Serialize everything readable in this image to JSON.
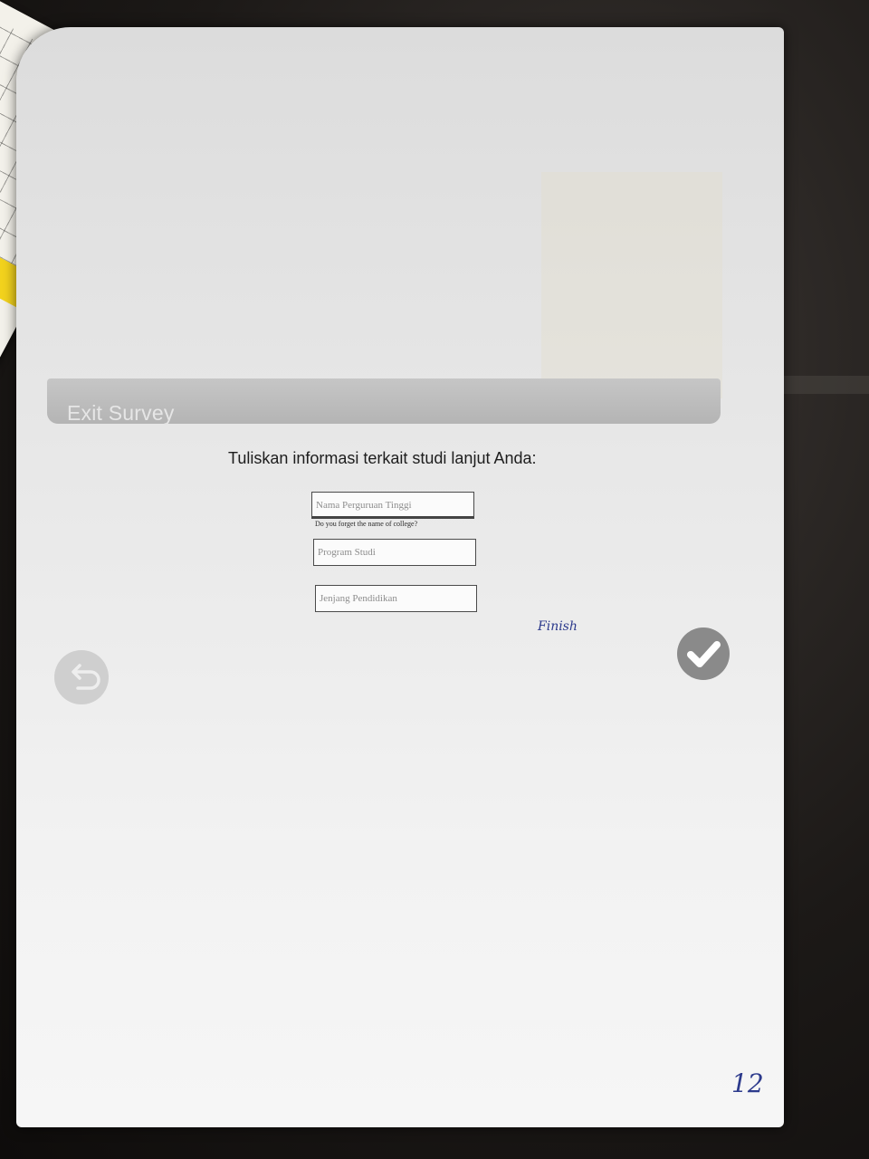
{
  "survey": {
    "banner_title": "Exit Survey",
    "question": "Tuliskan informasi terkait studi lanjut Anda:",
    "fields": {
      "college_placeholder": "Nama Perguruan Tinggi",
      "college_hint": "Do you forget the name of college?",
      "program_placeholder": "Program Studi",
      "level_placeholder": "Jenjang Pendidikan"
    },
    "back_button_icon": "back-arrow-icon",
    "finish_button_icon": "checkmark-icon"
  },
  "annotations": {
    "finish_note": "Finish",
    "page_number": "12"
  },
  "colors": {
    "banner": "#b9b9b9",
    "banner_text": "#e6e6e6",
    "handwriting_ink": "#2c3a8c",
    "button_gray": "#8a8a8a"
  }
}
